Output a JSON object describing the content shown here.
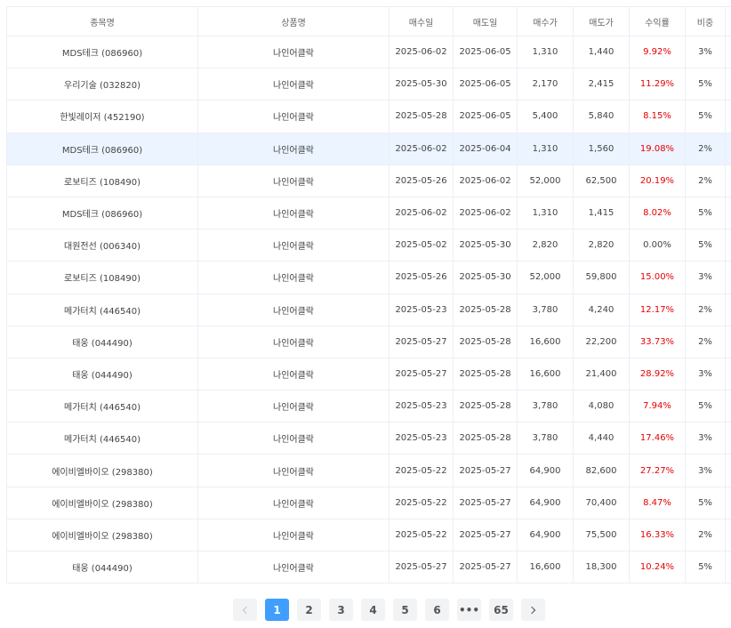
{
  "table": {
    "headers": [
      "종목명",
      "상품명",
      "매수일",
      "매도일",
      "매수가",
      "매도가",
      "수익률",
      "비중"
    ],
    "rows": [
      {
        "stock": "MDS테크 (086960)",
        "product": "나인어클락",
        "buy_date": "2025-06-02",
        "sell_date": "2025-06-05",
        "buy_price": "1,310",
        "sell_price": "1,440",
        "return": "9.92%",
        "weight": "3%"
      },
      {
        "stock": "우리기술 (032820)",
        "product": "나인어클락",
        "buy_date": "2025-05-30",
        "sell_date": "2025-06-05",
        "buy_price": "2,170",
        "sell_price": "2,415",
        "return": "11.29%",
        "weight": "5%"
      },
      {
        "stock": "한빛레이저 (452190)",
        "product": "나인어클락",
        "buy_date": "2025-05-28",
        "sell_date": "2025-06-05",
        "buy_price": "5,400",
        "sell_price": "5,840",
        "return": "8.15%",
        "weight": "5%"
      },
      {
        "stock": "MDS테크 (086960)",
        "product": "나인어클락",
        "buy_date": "2025-06-02",
        "sell_date": "2025-06-04",
        "buy_price": "1,310",
        "sell_price": "1,560",
        "return": "19.08%",
        "weight": "2%",
        "highlighted": true
      },
      {
        "stock": "로보티즈 (108490)",
        "product": "나인어클락",
        "buy_date": "2025-05-26",
        "sell_date": "2025-06-02",
        "buy_price": "52,000",
        "sell_price": "62,500",
        "return": "20.19%",
        "weight": "2%"
      },
      {
        "stock": "MDS테크 (086960)",
        "product": "나인어클락",
        "buy_date": "2025-06-02",
        "sell_date": "2025-06-02",
        "buy_price": "1,310",
        "sell_price": "1,415",
        "return": "8.02%",
        "weight": "5%"
      },
      {
        "stock": "대원전선 (006340)",
        "product": "나인어클락",
        "buy_date": "2025-05-02",
        "sell_date": "2025-05-30",
        "buy_price": "2,820",
        "sell_price": "2,820",
        "return": "0.00%",
        "weight": "5%"
      },
      {
        "stock": "로보티즈 (108490)",
        "product": "나인어클락",
        "buy_date": "2025-05-26",
        "sell_date": "2025-05-30",
        "buy_price": "52,000",
        "sell_price": "59,800",
        "return": "15.00%",
        "weight": "3%"
      },
      {
        "stock": "메가터치 (446540)",
        "product": "나인어클락",
        "buy_date": "2025-05-23",
        "sell_date": "2025-05-28",
        "buy_price": "3,780",
        "sell_price": "4,240",
        "return": "12.17%",
        "weight": "2%"
      },
      {
        "stock": "태웅 (044490)",
        "product": "나인어클락",
        "buy_date": "2025-05-27",
        "sell_date": "2025-05-28",
        "buy_price": "16,600",
        "sell_price": "22,200",
        "return": "33.73%",
        "weight": "2%"
      },
      {
        "stock": "태웅 (044490)",
        "product": "나인어클락",
        "buy_date": "2025-05-27",
        "sell_date": "2025-05-28",
        "buy_price": "16,600",
        "sell_price": "21,400",
        "return": "28.92%",
        "weight": "3%"
      },
      {
        "stock": "메가터치 (446540)",
        "product": "나인어클락",
        "buy_date": "2025-05-23",
        "sell_date": "2025-05-28",
        "buy_price": "3,780",
        "sell_price": "4,080",
        "return": "7.94%",
        "weight": "5%"
      },
      {
        "stock": "메가터치 (446540)",
        "product": "나인어클락",
        "buy_date": "2025-05-23",
        "sell_date": "2025-05-28",
        "buy_price": "3,780",
        "sell_price": "4,440",
        "return": "17.46%",
        "weight": "3%"
      },
      {
        "stock": "에이비엘바이오 (298380)",
        "product": "나인어클락",
        "buy_date": "2025-05-22",
        "sell_date": "2025-05-27",
        "buy_price": "64,900",
        "sell_price": "82,600",
        "return": "27.27%",
        "weight": "3%"
      },
      {
        "stock": "에이비엘바이오 (298380)",
        "product": "나인어클락",
        "buy_date": "2025-05-22",
        "sell_date": "2025-05-27",
        "buy_price": "64,900",
        "sell_price": "70,400",
        "return": "8.47%",
        "weight": "5%"
      },
      {
        "stock": "에이비엘바이오 (298380)",
        "product": "나인어클락",
        "buy_date": "2025-05-22",
        "sell_date": "2025-05-27",
        "buy_price": "64,900",
        "sell_price": "75,500",
        "return": "16.33%",
        "weight": "2%"
      },
      {
        "stock": "태웅 (044490)",
        "product": "나인어클락",
        "buy_date": "2025-05-27",
        "sell_date": "2025-05-27",
        "buy_price": "16,600",
        "sell_price": "18,300",
        "return": "10.24%",
        "weight": "5%"
      }
    ]
  },
  "pagination": {
    "prev_icon": "chevron-left-icon",
    "next_icon": "chevron-right-icon",
    "pages": [
      "1",
      "2",
      "3",
      "4",
      "5",
      "6",
      "•••",
      "65"
    ],
    "current": "1"
  },
  "colors": {
    "positive_return": "#e60000",
    "active_page": "#409eff",
    "highlight_row": "#ecf5ff"
  }
}
